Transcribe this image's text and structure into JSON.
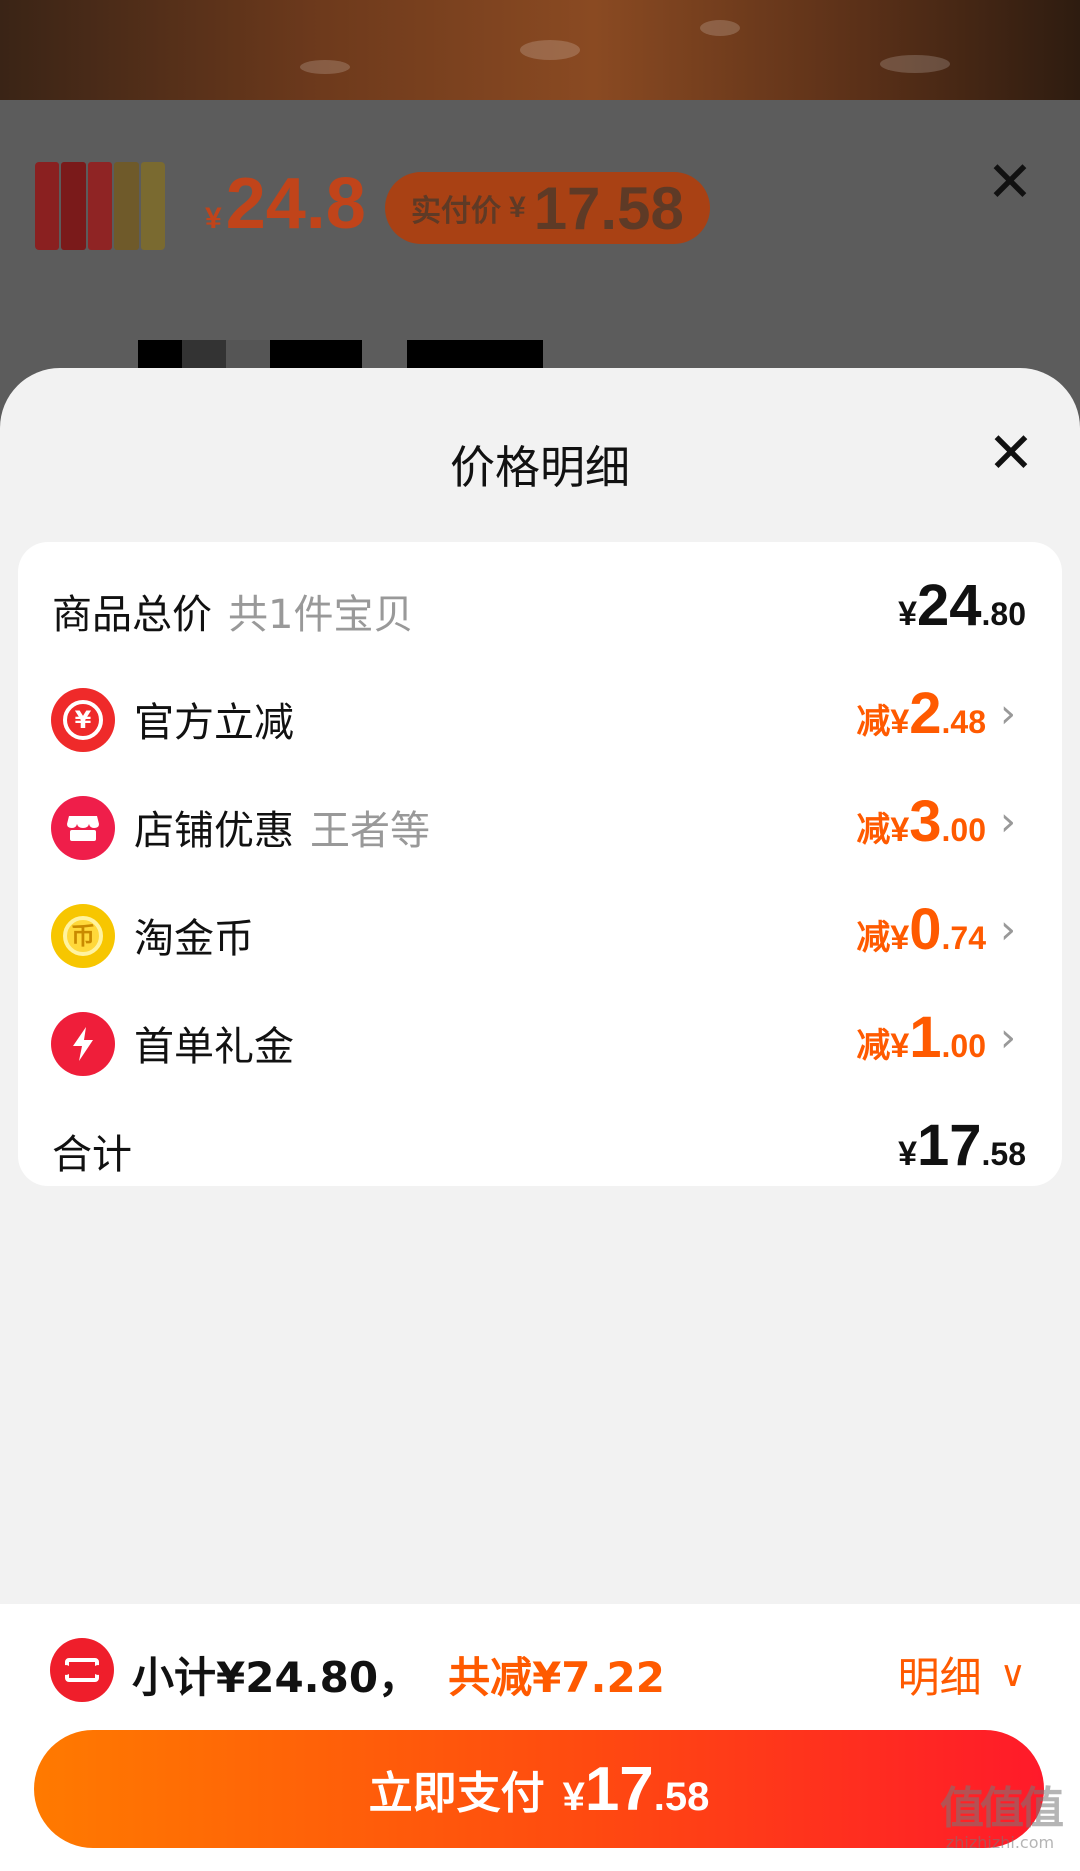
{
  "background_page": {
    "price_yen": "¥",
    "price": "24.8",
    "actual_price_label": "实付价",
    "actual_price_yen": "¥",
    "actual_price": "17.58",
    "close_glyph": "✕"
  },
  "panel": {
    "title": "价格明细",
    "close_glyph": "✕",
    "rows": [
      {
        "label": "商品总价",
        "sub": "共1件宝贝",
        "prefix": "¥",
        "int": "24",
        "dec": ".80"
      },
      {
        "icon": "yen-refund-icon",
        "icon_color": "#ef2a2a",
        "label": "官方立减",
        "prefix": "减¥",
        "int": "2",
        "dec": ".48"
      },
      {
        "icon": "shop-icon",
        "icon_color": "#ef1e4a",
        "label": "店铺优惠",
        "sub": "王者等",
        "prefix": "减¥",
        "int": "3",
        "dec": ".00"
      },
      {
        "icon": "gold-coin-icon",
        "icon_color": "#f7c600",
        "label": "淘金币",
        "prefix": "减¥",
        "int": "0",
        "dec": ".74"
      },
      {
        "icon": "lightning-icon",
        "icon_color": "#ef1e3a",
        "label": "首单礼金",
        "prefix": "减¥",
        "int": "1",
        "dec": ".00"
      },
      {
        "label": "合计",
        "prefix": "¥",
        "int": "17",
        "dec": ".58"
      }
    ],
    "chevron_glyph": "›"
  },
  "bottom": {
    "subtotal": "小计¥24.80，",
    "reduction": "共减¥7.22",
    "detail_label": "明细",
    "detail_chevron": "∨",
    "pay_label": "立即支付",
    "pay_prefix": "¥",
    "pay_int": "17",
    "pay_dec": ".58"
  },
  "watermark": {
    "main": "值值值",
    "sub": "zhizhizhi.com"
  },
  "colors": {
    "accent": "#ff5a00",
    "pay_gradient_start": "#ff7a00",
    "pay_gradient_end": "#ff1a2a",
    "panel_bg": "#f2f2f2"
  }
}
